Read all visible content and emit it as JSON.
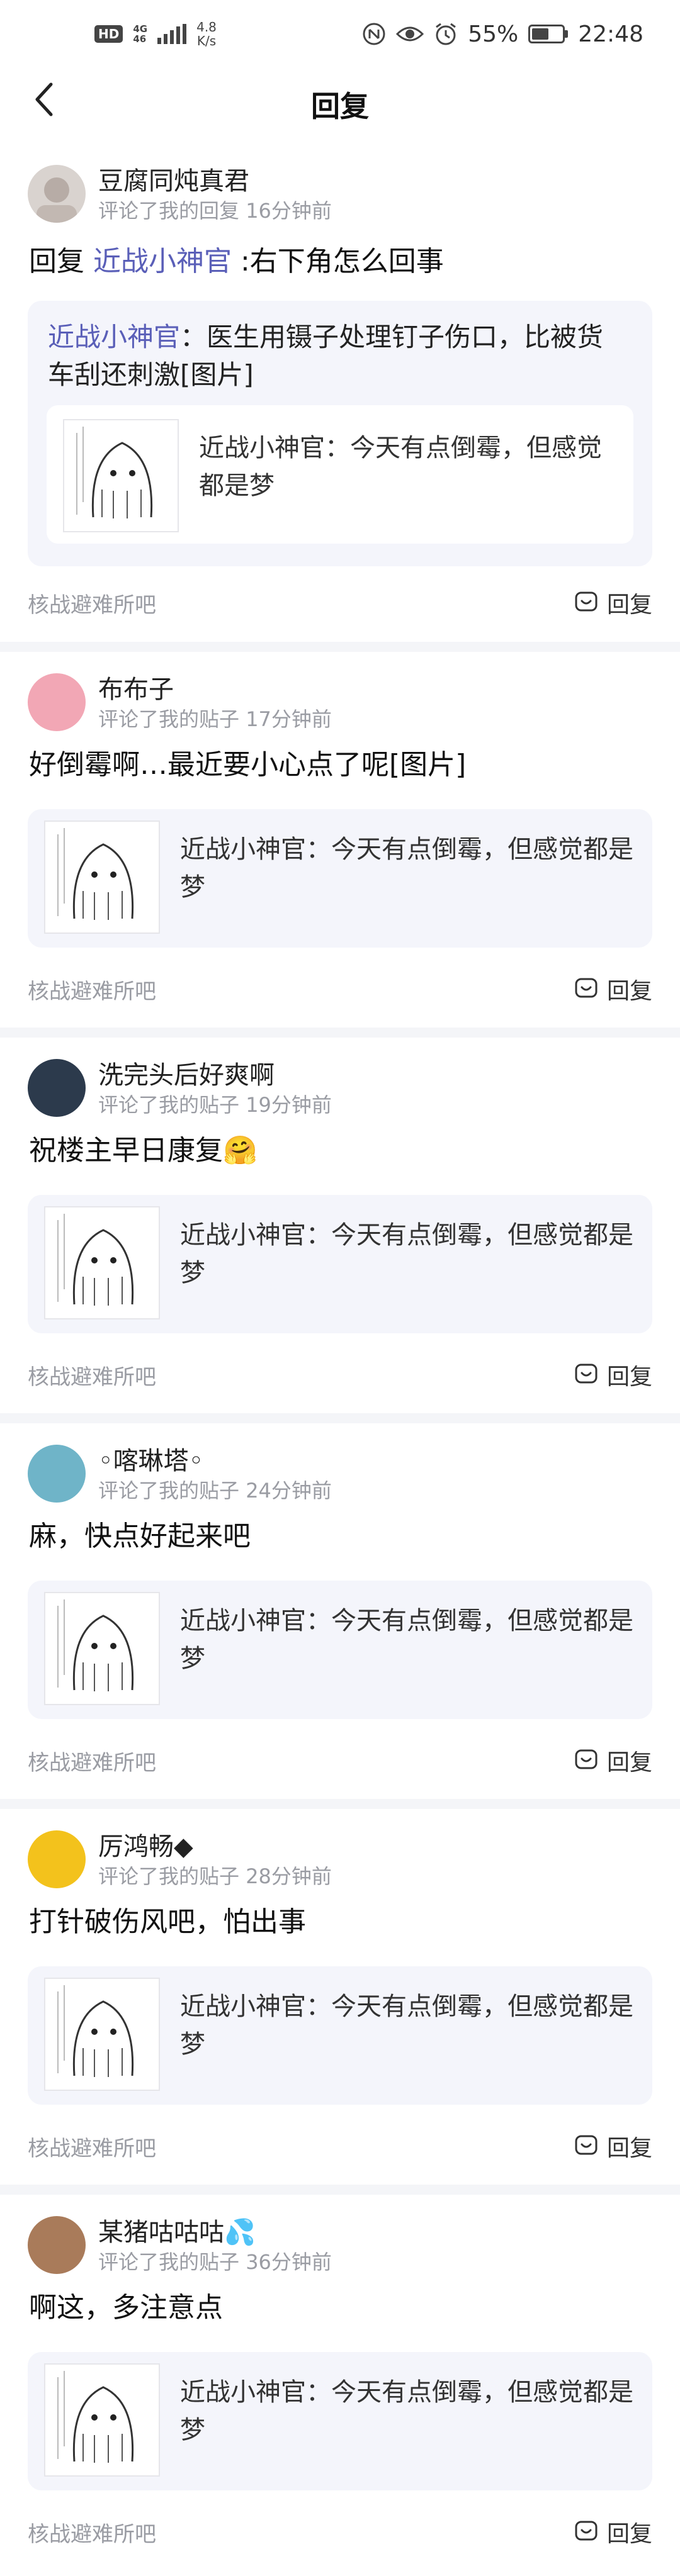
{
  "status_bar": {
    "hd": "HD",
    "signal_tech_top": "4G",
    "signal_tech_bottom": "46",
    "net_speed_value": "4.8",
    "net_speed_unit": "K/s",
    "battery_percent": "55%",
    "battery_level": 0.55,
    "time": "22:48"
  },
  "header": {
    "title": "回复",
    "back_icon": "back-chevron-icon"
  },
  "replies": [
    {
      "username": "豆腐同炖真君",
      "action": "评论了我的回复",
      "time": "16分钟前",
      "content_prefix": "回复 ",
      "content_mention": "近战小神官",
      "content_suffix": " :右下角怎么回事",
      "quote_mention": "近战小神官",
      "quote_body": "：医生用镊子处理钉子伤口，比被货车刮还刺激[图片]",
      "orig_text": "近战小神官：今天有点倒霉，但感觉都是梦",
      "forum": "核战避难所吧",
      "reply_label": "回复",
      "avatar_color": "#c9c2bd"
    },
    {
      "username": "布布子",
      "action": "评论了我的贴子",
      "time": "17分钟前",
      "content": "好倒霉啊…最近要小心点了呢[图片]",
      "orig_text": "近战小神官：今天有点倒霉，但感觉都是梦",
      "forum": "核战避难所吧",
      "reply_label": "回复",
      "avatar_color": "#f2a7b5"
    },
    {
      "username": "洗完头后好爽啊",
      "action": "评论了我的贴子",
      "time": "19分钟前",
      "content": "祝楼主早日康复🤗",
      "orig_text": "近战小神官：今天有点倒霉，但感觉都是梦",
      "forum": "核战避难所吧",
      "reply_label": "回复",
      "avatar_color": "#2c3a4c"
    },
    {
      "username": "◦喀琳塔◦",
      "action": "评论了我的贴子",
      "time": "24分钟前",
      "content": "麻，快点好起来吧",
      "orig_text": "近战小神官：今天有点倒霉，但感觉都是梦",
      "forum": "核战避难所吧",
      "reply_label": "回复",
      "avatar_color": "#6fb4c8"
    },
    {
      "username": "厉鸿畅◆",
      "action": "评论了我的贴子",
      "time": "28分钟前",
      "content": "打针破伤风吧，怕出事",
      "orig_text": "近战小神官：今天有点倒霉，但感觉都是梦",
      "forum": "核战避难所吧",
      "reply_label": "回复",
      "avatar_color": "#f3c21c"
    },
    {
      "username": "某猪咕咕咕💦",
      "action": "评论了我的贴子",
      "time": "36分钟前",
      "content": "啊这，多注意点",
      "orig_text": "近战小神官：今天有点倒霉，但感觉都是梦",
      "forum": "核战避难所吧",
      "reply_label": "回复",
      "avatar_color": "#a97b5a"
    }
  ]
}
